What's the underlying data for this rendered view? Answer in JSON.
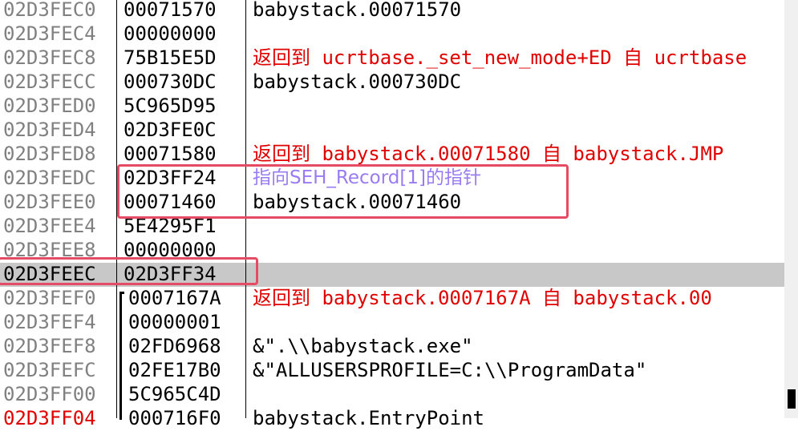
{
  "stack_rows": [
    {
      "addr": "02D3FEC0",
      "value": "00071570",
      "comment": "babystack.00071570"
    },
    {
      "addr": "02D3FEC4",
      "value": "00000000",
      "comment": ""
    },
    {
      "addr": "02D3FEC8",
      "value": "75B15E5D",
      "comment": "返回到 ucrtbase._set_new_mode+ED 自 ucrtbase"
    },
    {
      "addr": "02D3FECC",
      "value": "000730DC",
      "comment": "babystack.000730DC"
    },
    {
      "addr": "02D3FED0",
      "value": "5C965D95",
      "comment": ""
    },
    {
      "addr": "02D3FED4",
      "value": "02D3FE0C",
      "comment": ""
    },
    {
      "addr": "02D3FED8",
      "value": "00071580",
      "comment": "返回到 babystack.00071580 自 babystack.JMP"
    },
    {
      "addr": "02D3FEDC",
      "value": "02D3FF24",
      "comment": "指向SEH_Record[1]的指针"
    },
    {
      "addr": "02D3FEE0",
      "value": "00071460",
      "comment": "babystack.00071460"
    },
    {
      "addr": "02D3FEE4",
      "value": "5E4295F1",
      "comment": ""
    },
    {
      "addr": "02D3FEE8",
      "value": "00000000",
      "comment": ""
    },
    {
      "addr": "02D3FEEC",
      "value": "02D3FF34",
      "comment": ""
    },
    {
      "addr": "02D3FEF0",
      "value": "0007167A",
      "comment": "返回到 babystack.0007167A 自 babystack.00"
    },
    {
      "addr": "02D3FEF4",
      "value": "00000001",
      "comment": ""
    },
    {
      "addr": "02D3FEF8",
      "value": "02FD6968",
      "comment": "&\".\\\\babystack.exe\""
    },
    {
      "addr": "02D3FEFC",
      "value": "02FE17B0",
      "comment": "&\"ALLUSERSPROFILE=C:\\\\ProgramData\""
    },
    {
      "addr": "02D3FF00",
      "value": "5C965C4D",
      "comment": ""
    },
    {
      "addr": "02D3FF04",
      "value": "000716F0",
      "comment": "babystack.EntryPoint"
    }
  ],
  "colors": {
    "address_text": "#808080",
    "return_comment": "#e00000",
    "annotation_note": "#9a7cf2",
    "selected_row": "#c8c8c8",
    "annotation_box": "#e54b62"
  }
}
